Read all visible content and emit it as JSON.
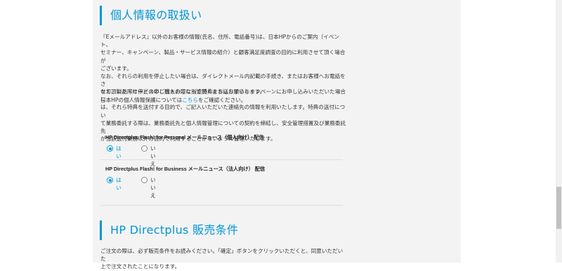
{
  "privacy": {
    "title": "個人情報の取扱い",
    "para1_lines": [
      "『Eメールアドレス』以外のお客様の情報(氏名、住所、電話番号)は、日本HPからのご案内（イベント、",
      "セミナー、キャンペーン、製品・サービス情報の紹介）と顧客満足度調査の目的に利用させて頂く場合が",
      "ございます。",
      "なお、それらの利用を停止したい場合は、ダイレクトメール内記載の手続き、またはお客様へお電話をさ",
      "せて頂いた際に停止の申し出をおこなって頂くようにお願いします。"
    ],
    "policy_prefix": "日本HPの個人情報保護については",
    "policy_link": "こちら",
    "policy_suffix": "をご確認ください。",
    "para2_lines": [
      "なお、製品・サービスのご購入の際に別途特典をお送りするキャンペーンにお申し込みいただいた場合に",
      "は、それら特典を送付する目的で、ご記入いただいた連絡先の情報を利用いたします。特典の送付につい",
      "て業務委託する際は、業務委託先と個人情報管理についての契約を締結し、安全管理措置及び業務委託先",
      "が当該送付業務以外の目的で利用することがないように管理いたします。"
    ]
  },
  "newsletters": [
    {
      "title": "HP Directplus Flash! for Personal メールニュース（個人向け） 配信",
      "yes_label": "はい",
      "no_label": "いいえ",
      "selected": "yes"
    },
    {
      "title": "HP Directplus Flash! for Business メールニュース（法人向け） 配信",
      "yes_label": "はい",
      "no_label": "いいえ",
      "selected": "yes"
    }
  ],
  "terms": {
    "title": "HP Directplus 販売条件",
    "lines": [
      "ご注文の際は、必ず販売条件をお読みください。「確定」ボタンをクリックいただくと、同意いただいた",
      "上で注文されたことになります。"
    ]
  },
  "colors": {
    "accent": "#0096d6",
    "panel_bg": "#f3f3f3",
    "text": "#333333"
  }
}
